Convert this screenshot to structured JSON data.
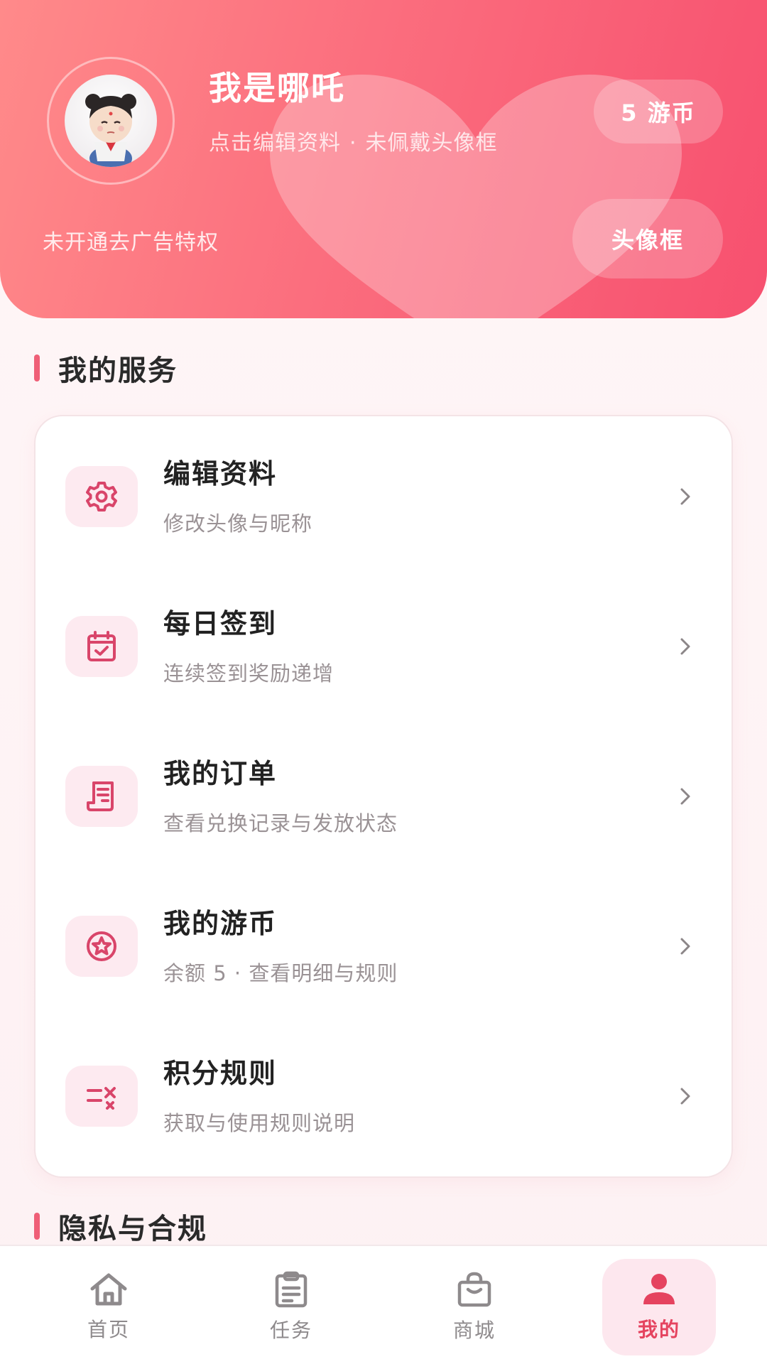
{
  "header": {
    "username": "我是哪吒",
    "edit_hint": "点击编辑资料",
    "separator": "·",
    "frame_status": "未佩戴头像框",
    "coins_badge": "5 游币",
    "ad_privilege": "未开通去广告特权",
    "avatar_frame_button": "头像框"
  },
  "services": {
    "title": "我的服务",
    "items": [
      {
        "icon": "gear-icon",
        "title": "编辑资料",
        "subtitle": "修改头像与昵称"
      },
      {
        "icon": "calendar-check-icon",
        "title": "每日签到",
        "subtitle": "连续签到奖励递增"
      },
      {
        "icon": "receipt-icon",
        "title": "我的订单",
        "subtitle": "查看兑换记录与发放状态"
      },
      {
        "icon": "star-coin-icon",
        "title": "我的游币",
        "subtitle": "余额 5 · 查看明细与规则"
      },
      {
        "icon": "rules-icon",
        "title": "积分规则",
        "subtitle": "获取与使用规则说明"
      }
    ]
  },
  "privacy": {
    "title": "隐私与合规"
  },
  "nav": {
    "items": [
      {
        "icon": "home-icon",
        "label": "首页",
        "active": false
      },
      {
        "icon": "task-clipboard-icon",
        "label": "任务",
        "active": false
      },
      {
        "icon": "shop-bag-icon",
        "label": "商城",
        "active": false
      },
      {
        "icon": "user-icon",
        "label": "我的",
        "active": true
      }
    ]
  },
  "colors": {
    "accent": "#e5435f",
    "header_start": "#ff8a8a",
    "header_end": "#f7506f",
    "icon_bg": "#fdeaf0"
  }
}
